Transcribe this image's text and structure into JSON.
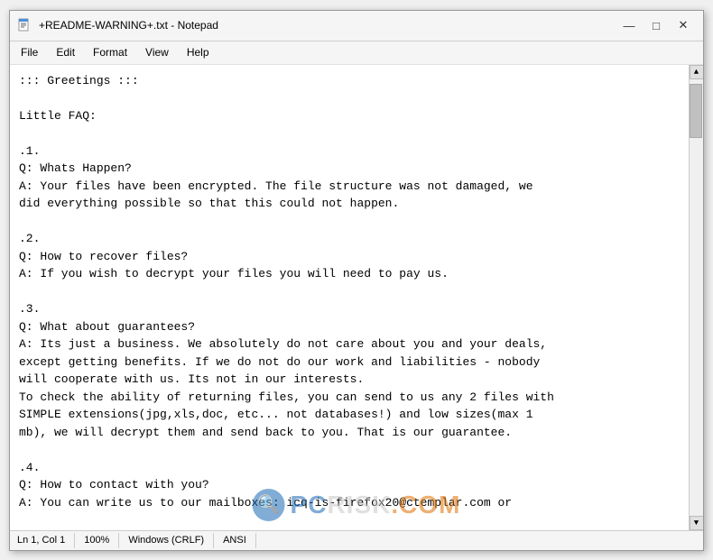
{
  "window": {
    "title": "+README-WARNING+.txt - Notepad",
    "icon": "📄"
  },
  "controls": {
    "minimize": "—",
    "maximize": "□",
    "close": "✕"
  },
  "menu": {
    "items": [
      "File",
      "Edit",
      "Format",
      "View",
      "Help"
    ]
  },
  "content": "::: Greetings :::\n\nLittle FAQ:\n\n.1.\nQ: Whats Happen?\nA: Your files have been encrypted. The file structure was not damaged, we\ndid everything possible so that this could not happen.\n\n.2.\nQ: How to recover files?\nA: If you wish to decrypt your files you will need to pay us.\n\n.3.\nQ: What about guarantees?\nA: Its just a business. We absolutely do not care about you and your deals,\nexcept getting benefits. If we do not do our work and liabilities - nobody\nwill cooperate with us. Its not in our interests.\nTo check the ability of returning files, you can send to us any 2 files with\nSIMPLE extensions(jpg,xls,doc, etc... not databases!) and low sizes(max 1\nmb), we will decrypt them and send back to you. That is our guarantee.\n\n.4.\nQ: How to contact with you?\nA: You can write us to our mailboxes: icq-is-firefox20@ctemplar.com or",
  "status": {
    "position": "Ln 1, Col 1",
    "zoom": "100%",
    "line_ending": "Windows (CRLF)",
    "encoding": "ANSI"
  },
  "watermark": {
    "site": "PC RISK .COM",
    "label_pc": "PC",
    "label_risk": "RISK",
    "label_com": ".COM"
  }
}
